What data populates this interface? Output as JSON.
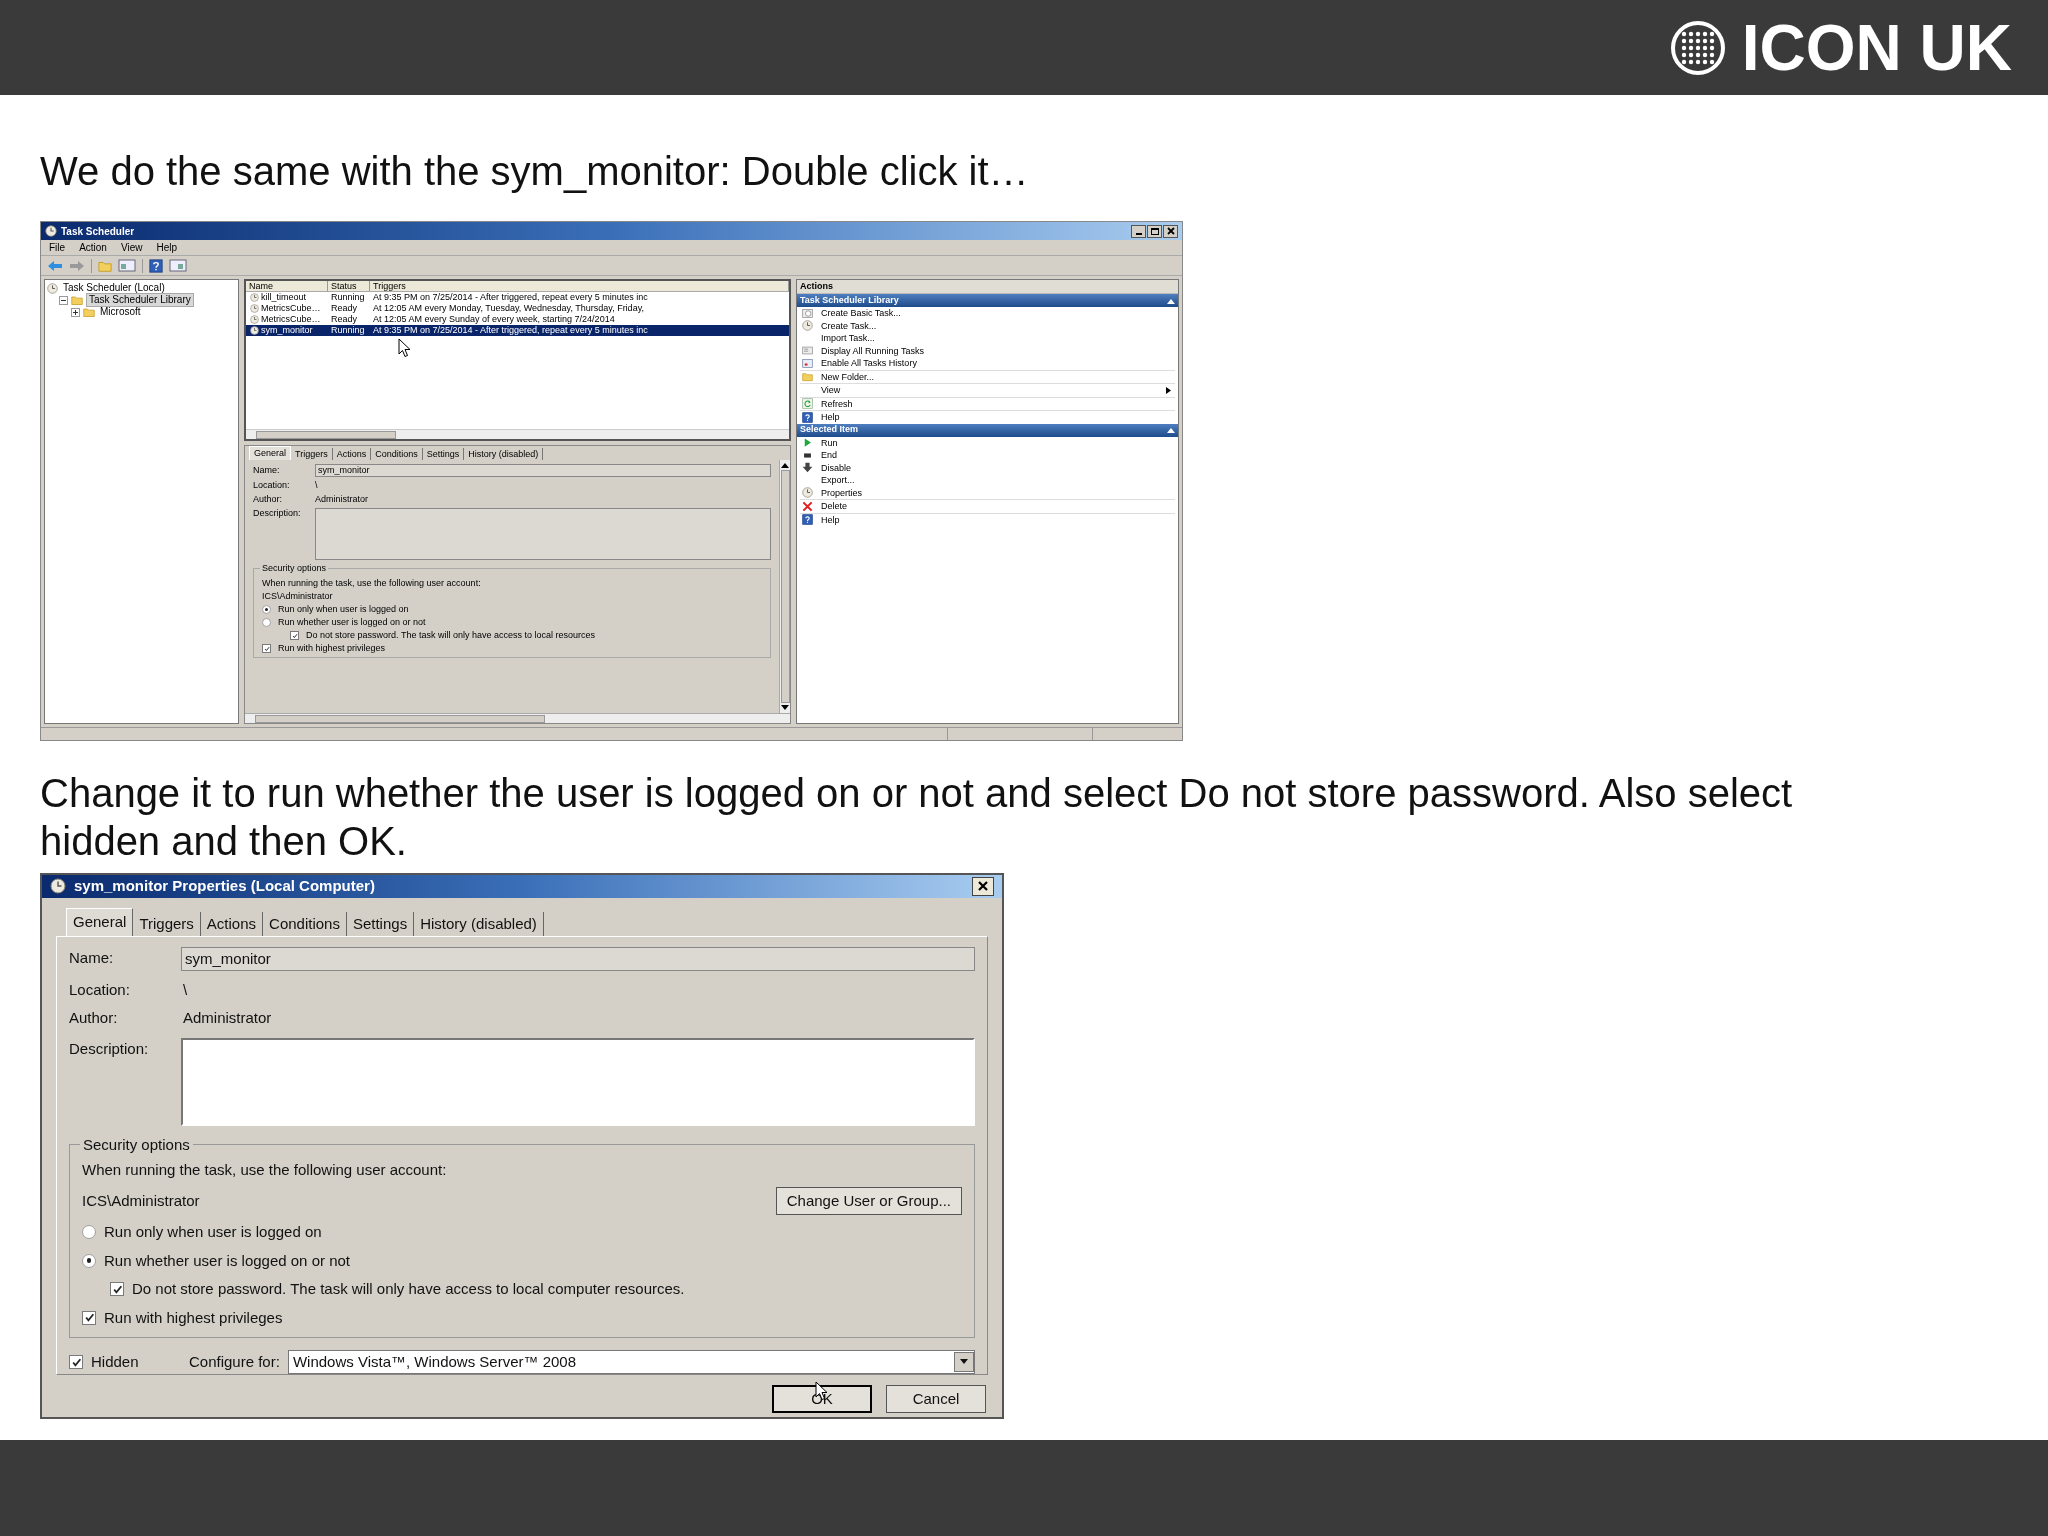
{
  "header": {
    "logo": "ICON UK"
  },
  "caption_1": "We do the same with the sym_monitor: Double click it…",
  "task_scheduler": {
    "title": "Task Scheduler",
    "menu": [
      "File",
      "Action",
      "View",
      "Help"
    ],
    "tree": [
      {
        "label": "Task Scheduler (Local)",
        "selected": false,
        "children": [
          {
            "label": "Task Scheduler Library",
            "selected": true,
            "expanded": true,
            "children": [
              {
                "label": "Microsoft",
                "selected": false,
                "expanded": false
              }
            ]
          }
        ]
      }
    ],
    "table": {
      "columns": [
        "Name",
        "Status",
        "Triggers"
      ],
      "rows": [
        {
          "name": "kill_timeout",
          "status": "Running",
          "triggers": "At 9:35 PM on 7/25/2014 - After triggered, repeat every 5 minutes inc",
          "selected": false
        },
        {
          "name": "MetricsCube…",
          "status": "Ready",
          "triggers": "At 12:05 AM every Monday, Tuesday, Wednesday, Thursday, Friday,",
          "selected": false
        },
        {
          "name": "MetricsCube…",
          "status": "Ready",
          "triggers": "At 12:05 AM every Sunday of every week, starting 7/24/2014",
          "selected": false
        },
        {
          "name": "sym_monitor",
          "status": "Running",
          "triggers": "At 9:35 PM on 7/25/2014 - After triggered, repeat every 5 minutes inc",
          "selected": true
        }
      ]
    },
    "tabs": [
      {
        "label": "General",
        "selected": true
      },
      {
        "label": "Triggers",
        "selected": false
      },
      {
        "label": "Actions",
        "selected": false
      },
      {
        "label": "Conditions",
        "selected": false
      },
      {
        "label": "Settings",
        "selected": false
      },
      {
        "label": "History (disabled)",
        "selected": false
      }
    ],
    "details": {
      "name_label": "Name:",
      "name_value": "sym_monitor",
      "location_label": "Location:",
      "location_value": "\\",
      "author_label": "Author:",
      "author_value": "Administrator",
      "description_label": "Description:",
      "security_title": "Security options",
      "account_prompt": "When running the task, use the following user account:",
      "account": "ICS\\Administrator",
      "options": [
        {
          "kind": "radio",
          "label": "Run only when user is logged on",
          "selected": true
        },
        {
          "kind": "radio",
          "label": "Run whether user is logged on or not",
          "selected": false,
          "children": [
            {
              "kind": "checkbox",
              "label": "Do not store password.  The task will only have access to local resources",
              "checked": true
            }
          ]
        },
        {
          "kind": "checkbox",
          "label": "Run with highest privileges",
          "checked": true
        }
      ]
    },
    "actions": {
      "title": "Actions",
      "sections": [
        {
          "title": "Task Scheduler Library",
          "expanded": true,
          "groups": [
            [
              {
                "label": "Create Basic Task..."
              },
              {
                "label": "Create Task..."
              },
              {
                "label": "Import Task..."
              },
              {
                "label": "Display All Running Tasks"
              },
              {
                "label": "Enable All Tasks History"
              }
            ],
            [
              {
                "label": "New Folder..."
              }
            ],
            [
              {
                "label": "View",
                "submenu": true
              }
            ],
            [
              {
                "label": "Refresh"
              }
            ],
            [
              {
                "label": "Help"
              }
            ]
          ]
        },
        {
          "title": "Selected Item",
          "expanded": true,
          "groups": [
            [
              {
                "label": "Run"
              },
              {
                "label": "End"
              },
              {
                "label": "Disable"
              },
              {
                "label": "Export..."
              },
              {
                "label": "Properties"
              }
            ],
            [
              {
                "label": "Delete"
              }
            ],
            [
              {
                "label": "Help"
              }
            ]
          ]
        }
      ]
    }
  },
  "caption_2": "Change it to run whether the user is logged on or not and select Do not store password. Also select hidden and then OK.",
  "properties_dialog": {
    "title": "sym_monitor Properties (Local Computer)",
    "tabs": [
      {
        "label": "General",
        "selected": true
      },
      {
        "label": "Triggers",
        "selected": false
      },
      {
        "label": "Actions",
        "selected": false
      },
      {
        "label": "Conditions",
        "selected": false
      },
      {
        "label": "Settings",
        "selected": false
      },
      {
        "label": "History (disabled)",
        "selected": false
      }
    ],
    "name_label": "Name:",
    "name_value": "sym_monitor",
    "location_label": "Location:",
    "location_value": "\\",
    "author_label": "Author:",
    "author_value": "Administrator",
    "description_label": "Description:",
    "security_title": "Security options",
    "account_prompt": "When running the task, use the following user account:",
    "account": "ICS\\Administrator",
    "change_button": "Change User or Group...",
    "options": [
      {
        "kind": "radio",
        "label": "Run only when user is logged on",
        "selected": false
      },
      {
        "kind": "radio",
        "label": "Run whether user is logged on or not",
        "selected": true,
        "children": [
          {
            "kind": "checkbox",
            "label": "Do not store password.  The task will only have access to local computer resources.",
            "checked": true
          }
        ]
      },
      {
        "kind": "checkbox",
        "label": "Run with highest privileges",
        "checked": true
      }
    ],
    "hidden": {
      "label": "Hidden",
      "checked": true
    },
    "configure_label": "Configure for:",
    "configure_value": "Windows Vista™, Windows Server™ 2008",
    "buttons": [
      "OK",
      "Cancel"
    ]
  }
}
